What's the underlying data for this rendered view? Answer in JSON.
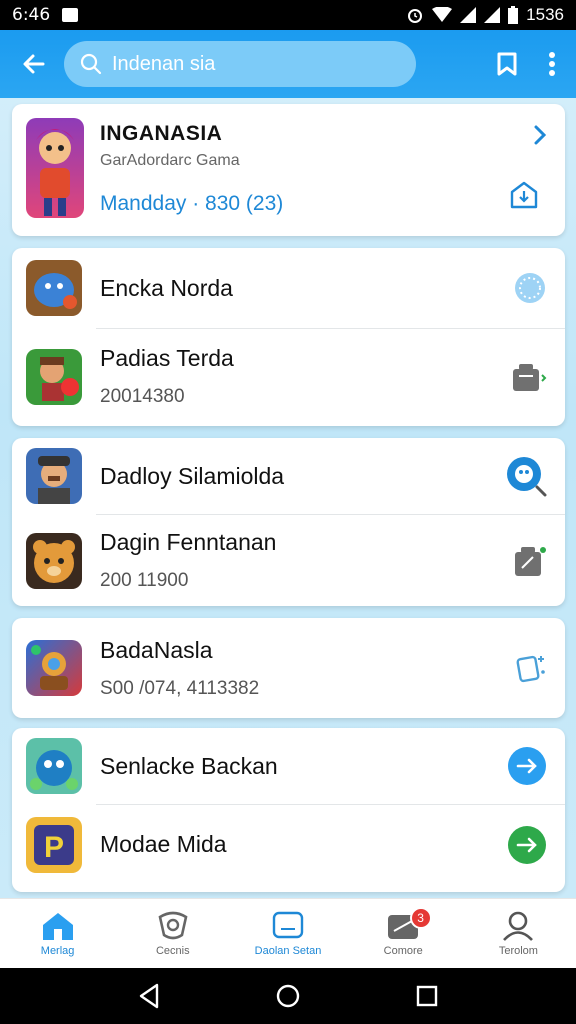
{
  "status_bar": {
    "time": "6:46",
    "battery": "1536"
  },
  "search": {
    "value": "Indenan sia"
  },
  "featured": {
    "title": "INGANASIA",
    "subtitle": "GarAdordarc Gama",
    "meta": "Mandday  ·  830 (23)"
  },
  "groups": [
    {
      "items": [
        {
          "title": "Encka Norda",
          "subtitle": ""
        },
        {
          "title": "Padias Terda",
          "subtitle": "20014380"
        }
      ]
    },
    {
      "items": [
        {
          "title": "Dadloy Silamiolda",
          "subtitle": ""
        },
        {
          "title": "Dagin Fenntanan",
          "subtitle": "200 11900"
        }
      ]
    },
    {
      "items": [
        {
          "title": "BadaNasla",
          "subtitle": "S00 /074, 4113382"
        }
      ]
    },
    {
      "items": [
        {
          "title": "Senlacke Backan",
          "subtitle": ""
        },
        {
          "title": "Modae Mida",
          "subtitle": ""
        }
      ]
    }
  ],
  "bottom_nav": [
    {
      "label": "Merlag",
      "icon": "home-icon",
      "active": true
    },
    {
      "label": "Cecnis",
      "icon": "gamepad-icon",
      "active": false
    },
    {
      "label": "Daolan Setan",
      "icon": "chat-icon",
      "active": false
    },
    {
      "label": "Comore",
      "icon": "store-icon",
      "active": false,
      "badge": "3"
    },
    {
      "label": "Terolom",
      "icon": "profile-icon",
      "active": false
    }
  ],
  "colors": {
    "app_bar": "#1b9bf0",
    "accent": "#1e88d6",
    "green": "#2ea94a"
  }
}
